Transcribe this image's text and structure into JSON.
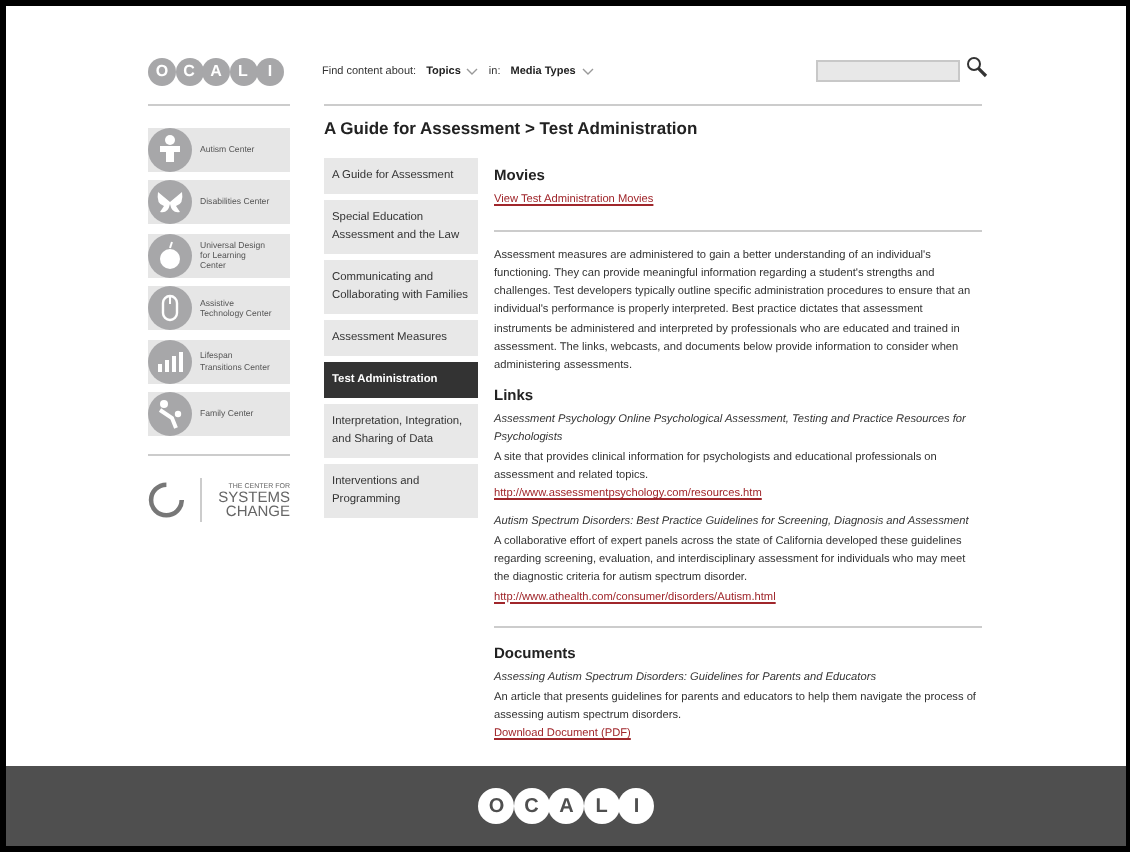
{
  "header": {
    "logo_letters": [
      "O",
      "C",
      "A",
      "L",
      "I"
    ],
    "filter_label": "Find content about:",
    "topics": "Topics",
    "in_label": "in:",
    "media_types": "Media Types"
  },
  "centers": [
    {
      "label": "Autism Center",
      "kind": "figure"
    },
    {
      "label": "Disabilities Center",
      "kind": "butterfly"
    },
    {
      "label": "Universal Design for Learning Center",
      "kind": "apple"
    },
    {
      "label": "Assistive Technology Center",
      "kind": "mouse"
    },
    {
      "label": "Lifespan Transitions Center",
      "kind": "bars"
    },
    {
      "label": "Family Center",
      "kind": "family"
    }
  ],
  "systems_change": {
    "small": "THE CENTER FOR",
    "line1": "SYSTEMS",
    "line2": "CHANGE"
  },
  "breadcrumb": {
    "parent": "A Guide for Assessment",
    "separator": ">",
    "current": "Test Administration"
  },
  "nav": [
    {
      "label": "A Guide for Assessment",
      "selected": false
    },
    {
      "label": "Special Education Assessment and the Law",
      "selected": false
    },
    {
      "label": "Communicating and Collaborating with Families",
      "selected": false
    },
    {
      "label": "Assessment Measures",
      "selected": false
    },
    {
      "label": "Test Administration",
      "selected": true
    },
    {
      "label": "Interpretation, Integration, and Sharing of Data",
      "selected": false
    },
    {
      "label": "Interventions and Programming",
      "selected": false
    }
  ],
  "movies": {
    "heading": "Movies",
    "link": "View Test Administration Movies"
  },
  "intro": "Assessment measures are administered to gain a better understanding of an individual's functioning.  They can provide meaningful information regarding a student's strengths and challenges. Test developers typically outline specific administration procedures to ensure that an individual's performance is properly interpreted.  Best practice dictates that assessment instruments be administered and interpreted by professionals who are educated and trained in assessment.  The links, webcasts, and documents below provide information to consider when administering assessments.",
  "links": {
    "heading": "Links",
    "items": [
      {
        "title": "Assessment Psychology Online Psychological Assessment, Testing and Practice Resources for Psychologists",
        "description": "A site that provides clinical information for psychologists and educational professionals on assessment and related topics.",
        "url": "http://www.assessmentpsychology.com/resources.htm"
      },
      {
        "title": "Autism Spectrum Disorders: Best Practice Guidelines for Screening, Diagnosis and Assessment",
        "description": "A collaborative effort of expert panels across the state of California developed these guidelines regarding screening, evaluation, and interdisciplinary assessment for individuals who may meet the diagnostic criteria for autism spectrum disorder.",
        "url": "http://www.athealth.com/consumer/disorders/Autism.html"
      }
    ]
  },
  "documents": {
    "heading": "Documents",
    "items": [
      {
        "title": "Assessing Autism Spectrum Disorders: Guidelines for Parents and Educators",
        "description": "An article that presents guidelines for parents and educators to help them navigate the process of assessing autism spectrum disorders.",
        "link": "Download Document (PDF)"
      }
    ]
  },
  "footer": {
    "logo_letters": [
      "O",
      "C",
      "A",
      "L",
      "I"
    ]
  }
}
